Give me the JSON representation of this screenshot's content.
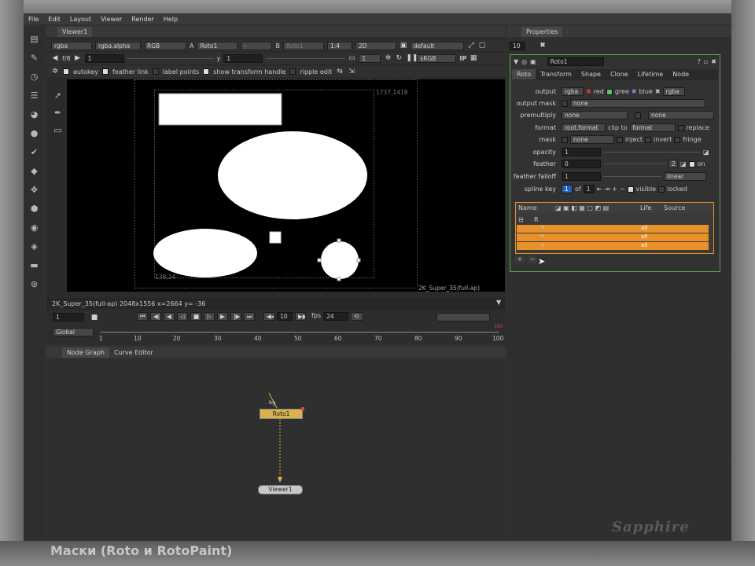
{
  "menu": [
    "File",
    "Edit",
    "Layout",
    "Viewer",
    "Render",
    "Help"
  ],
  "viewer": {
    "tab": "Viewer1",
    "row1": {
      "channels": "rgba",
      "alpha": "rgba.alpha",
      "display": "RGB",
      "a_label": "A",
      "a_input": "Roto1",
      "a_op": "-",
      "b_label": "B",
      "b_input": "Roto1",
      "proxy": "1:4",
      "mode": "2D",
      "lut": "default"
    },
    "row2": {
      "fstop": "f/8",
      "gain": "1",
      "y_label": "y",
      "gamma": "1",
      "frame": "1",
      "colorspace": "sRGB",
      "ip": "IP"
    },
    "row3": {
      "autokey": "autokey",
      "feather_link": "feather link",
      "label_points": "label points",
      "show_transform": "show transform handle",
      "ripple_edit": "ripple edit"
    },
    "coord_top": "1737,1418",
    "coord_bottom": "138,24",
    "format_label": "2K_Super_35(full-ap)",
    "status": "2K_Super_35(full-ap) 2048x1556  x=2664 y= -36"
  },
  "timeline": {
    "frame": "1",
    "step": "10",
    "fps_label": "fps",
    "fps": "24",
    "scope": "Global",
    "ticks": [
      "1",
      "10",
      "20",
      "30",
      "40",
      "50",
      "60",
      "70",
      "80",
      "90",
      "100"
    ],
    "end": "100"
  },
  "nodegraph": {
    "tabs": [
      "Node Graph",
      "Curve Editor"
    ],
    "nodes": {
      "roto": "Roto1",
      "viewer": "Viewer1"
    },
    "input_label": "bg"
  },
  "properties": {
    "title": "Properties",
    "max_panels": "10",
    "node_name": "Roto1",
    "tabs": [
      "Roto",
      "Transform",
      "Shape",
      "Clone",
      "Lifetime",
      "Node"
    ],
    "output_label": "output",
    "output": "rgba",
    "red": "red",
    "green": "gree",
    "blue": "blue",
    "output2": "rgba",
    "output_mask_label": "output mask",
    "output_mask": "none",
    "premultiply_label": "premultiply",
    "premultiply": "none",
    "premultiply2": "none",
    "format_label": "format",
    "format": "root.format",
    "clip_to_label": "clip to",
    "clip_to": "format",
    "replace": "replace",
    "mask_label": "mask",
    "mask": "none",
    "inject": "inject",
    "invert": "invert",
    "fringe": "fringe",
    "opacity_label": "opacity",
    "opacity": "1",
    "feather_label": "feather",
    "feather": "0",
    "feather_channels": "2",
    "feather_on": "on",
    "feather_falloff_label": "feather falloff",
    "feather_falloff": "1",
    "falloff_type": "linear",
    "spline_key_label": "spline key",
    "spline_key": "1",
    "of": "of",
    "of_value": "1",
    "visible": "visible",
    "locked": "locked",
    "table_headers": [
      "Name",
      "Life",
      "Source"
    ],
    "root_row": "R",
    "life_values": [
      "all",
      "all",
      "all"
    ]
  },
  "watermark": "Sapphire",
  "caption": "Маски (Roto и RotoPaint)",
  "colors": {
    "accent": "#e8902a",
    "roto_node": "#d8b24a",
    "panel_border": "#5aa34a"
  }
}
